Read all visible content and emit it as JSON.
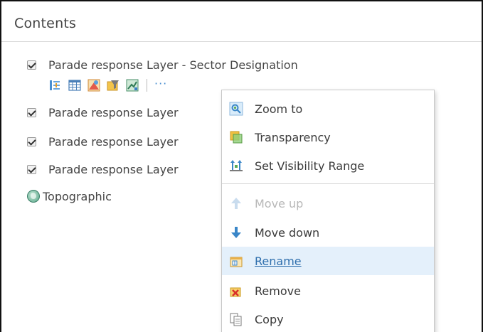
{
  "panel": {
    "title": "Contents"
  },
  "layers": [
    {
      "label": "Parade response Layer - Sector Designation",
      "checked": true
    },
    {
      "label": "Parade response Layer",
      "checked": true
    },
    {
      "label": "Parade response Layer",
      "checked": true
    },
    {
      "label": "Parade response Layer",
      "checked": true
    }
  ],
  "basemap": {
    "label": "Topographic",
    "icon": "globe-icon"
  },
  "toolbar": {
    "icons": [
      "legend-icon",
      "table-icon",
      "style-icon",
      "filter-icon",
      "analysis-icon"
    ],
    "more": "···"
  },
  "context_menu": {
    "items": [
      {
        "label": "Zoom to",
        "icon": "zoom-to-icon",
        "state": "normal"
      },
      {
        "label": "Transparency",
        "icon": "transparency-icon",
        "state": "normal"
      },
      {
        "label": "Set Visibility Range",
        "icon": "visibility-range-icon",
        "state": "normal"
      },
      {
        "label": "Move up",
        "icon": "arrow-up-icon",
        "state": "disabled"
      },
      {
        "label": "Move down",
        "icon": "arrow-down-icon",
        "state": "normal"
      },
      {
        "label": "Rename",
        "icon": "rename-icon",
        "state": "hover"
      },
      {
        "label": "Remove",
        "icon": "remove-icon",
        "state": "normal"
      },
      {
        "label": "Copy",
        "icon": "copy-icon",
        "state": "normal"
      }
    ]
  },
  "colors": {
    "accent_blue": "#4a8fd1",
    "hover_bg": "#e4f0fb",
    "link": "#2f6fad",
    "disabled_text": "#b8b8b8"
  }
}
